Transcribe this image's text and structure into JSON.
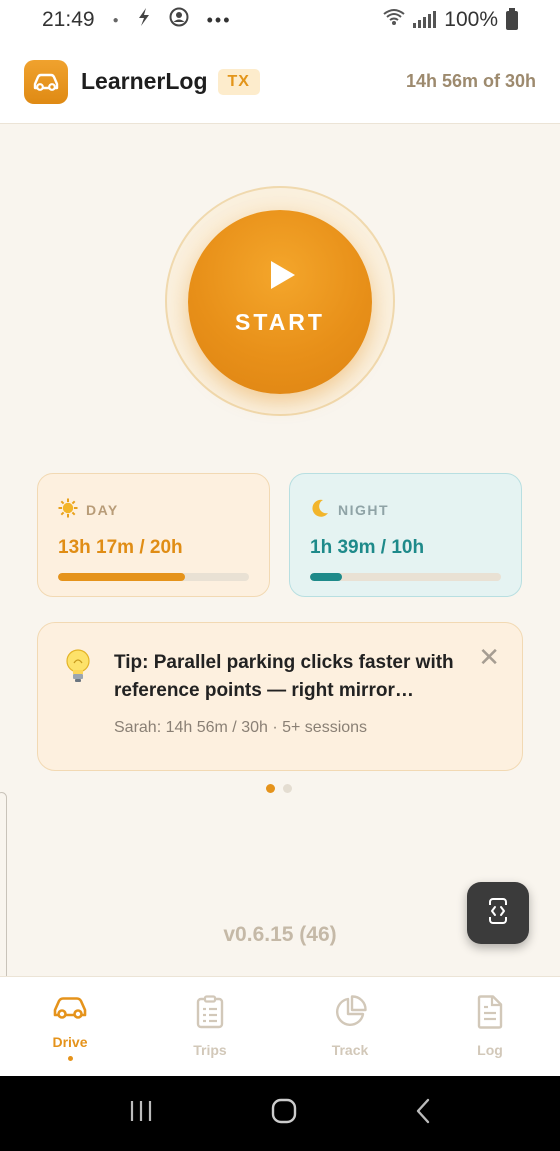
{
  "status_bar": {
    "time": "21:49",
    "battery_text": "100%",
    "icons": [
      "dot-icon",
      "flash-icon",
      "account-icon",
      "more-dots-icon",
      "wifi-icon",
      "signal-icon",
      "battery-icon"
    ]
  },
  "header": {
    "app_name": "LearnerLog",
    "state_badge": "TX",
    "hours_summary": "14h 56m of 30h"
  },
  "start_button": {
    "label": "START"
  },
  "day_card": {
    "label": "DAY",
    "value": "13h 17m / 20h",
    "progress": 0.664
  },
  "night_card": {
    "label": "NIGHT",
    "value": "1h 39m / 10h",
    "progress": 0.165
  },
  "tip": {
    "text": "Tip: Parallel parking clicks faster with reference points — right mirror…",
    "meta": "Sarah: 14h 56m / 30h · 5+ sessions"
  },
  "carousel": {
    "page_count": 2,
    "active_index": 0
  },
  "version": "v0.6.15 (46)",
  "bottom_nav": {
    "items": [
      {
        "label": "Drive",
        "icon": "car-icon",
        "active": true
      },
      {
        "label": "Trips",
        "icon": "clipboard-icon",
        "active": false
      },
      {
        "label": "Track",
        "icon": "pie-chart-icon",
        "active": false
      },
      {
        "label": "Log",
        "icon": "document-icon",
        "active": false
      }
    ]
  },
  "colors": {
    "accent": "#e5931b",
    "night": "#1e8a8a",
    "background": "#f9f5ee"
  }
}
